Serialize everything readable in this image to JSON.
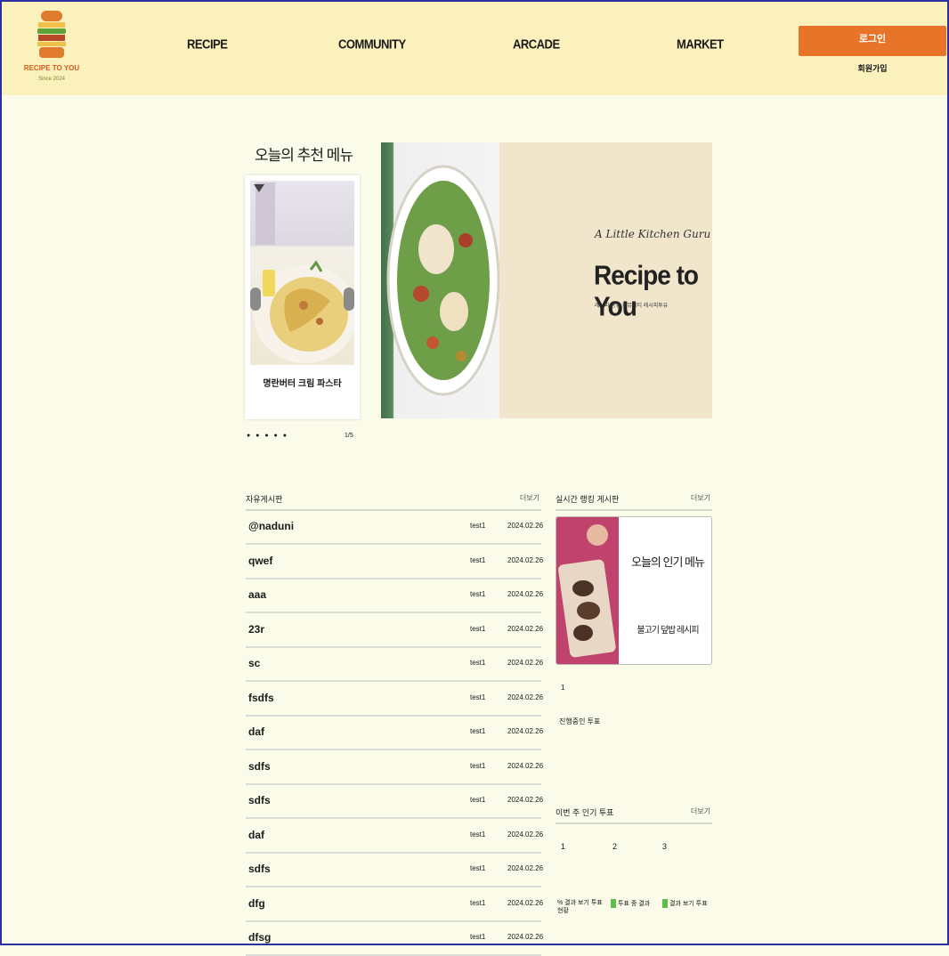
{
  "header": {
    "logo_text": "RECIPE TO YOU",
    "logo_sub": "Since 2024",
    "nav": [
      "RECIPE",
      "COMMUNITY",
      "ARCADE",
      "MARKET"
    ],
    "login_label": "로그인",
    "signup_label": "회원가입"
  },
  "recommended": {
    "title": "오늘의 추천 메뉴",
    "caption": "명란버터 크림 파스타",
    "dots": "● ● ● ● ●",
    "page": "1/5"
  },
  "banner": {
    "script": "A Little Kitchen Guru",
    "title": "Recipe to You",
    "subtitle": "레시피 공유 커뮤니티 레시피투유"
  },
  "board": {
    "title": "자유게시판",
    "more": "더보기",
    "rows": [
      {
        "title": "@naduni",
        "author": "test1",
        "date": "2024.02.26"
      },
      {
        "title": "qwef",
        "author": "test1",
        "date": "2024.02.26"
      },
      {
        "title": "aaa",
        "author": "test1",
        "date": "2024.02.26"
      },
      {
        "title": "23r",
        "author": "test1",
        "date": "2024.02.26"
      },
      {
        "title": "sc",
        "author": "test1",
        "date": "2024.02.26"
      },
      {
        "title": "fsdfs",
        "author": "test1",
        "date": "2024.02.26"
      },
      {
        "title": "daf",
        "author": "test1",
        "date": "2024.02.26"
      },
      {
        "title": "sdfs",
        "author": "test1",
        "date": "2024.02.26"
      },
      {
        "title": "sdfs",
        "author": "test1",
        "date": "2024.02.26"
      },
      {
        "title": "daf",
        "author": "test1",
        "date": "2024.02.26"
      },
      {
        "title": "sdfs",
        "author": "test1",
        "date": "2024.02.26"
      },
      {
        "title": "dfg",
        "author": "test1",
        "date": "2024.02.26"
      },
      {
        "title": "dfsg",
        "author": "test1",
        "date": "2024.02.26"
      }
    ]
  },
  "side": {
    "title": "실시간 랭킹 게시판",
    "more": "더보기",
    "line1": "오늘의 인기 메뉴",
    "line2": "불고기 덮밥 레시피",
    "dot": "1",
    "status": "진행중인 투표"
  },
  "poll": {
    "title": "이번 주 인기 투표",
    "more": "더보기",
    "options": [
      "1",
      "2",
      "3"
    ],
    "results": [
      {
        "label": "% 결과 보기 투표 현황",
        "swatch": false
      },
      {
        "label": "투표 중 결과",
        "swatch": true
      },
      {
        "label": "결과 보기 투표",
        "swatch": true
      }
    ]
  },
  "colors": {
    "header_bg": "#fbf1bd",
    "page_bg": "#fbfbea",
    "accent": "#e8742a"
  }
}
